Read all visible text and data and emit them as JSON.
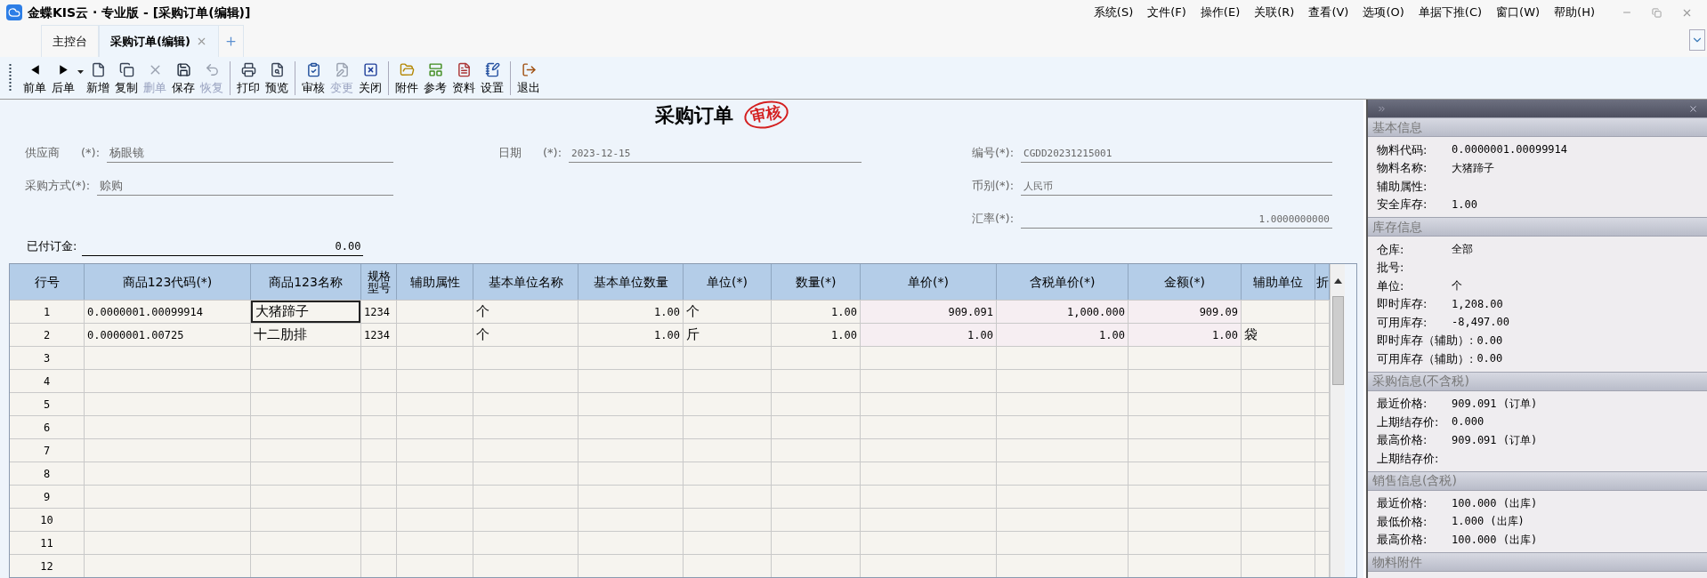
{
  "window": {
    "title": "金蝶KIS云 · 专业版 - [采购订单(编辑)]"
  },
  "menu": [
    "系统(S)",
    "文件(F)",
    "操作(E)",
    "关联(R)",
    "查看(V)",
    "选项(O)",
    "单据下推(C)",
    "窗口(W)",
    "帮助(H)"
  ],
  "tabs": [
    {
      "label": "主控台",
      "selected": false,
      "closable": false
    },
    {
      "label": "采购订单(编辑)",
      "selected": true,
      "closable": true
    }
  ],
  "toolbar": [
    [
      {
        "label": "前单",
        "disabled": false,
        "dropdown": false
      },
      {
        "label": "后单",
        "disabled": false,
        "dropdown": true
      },
      {
        "label": "新增",
        "disabled": false,
        "dropdown": false
      },
      {
        "label": "复制",
        "disabled": false,
        "dropdown": false
      },
      {
        "label": "删单",
        "disabled": true,
        "dropdown": false
      },
      {
        "label": "保存",
        "disabled": false,
        "dropdown": false
      },
      {
        "label": "恢复",
        "disabled": true,
        "dropdown": false
      }
    ],
    [
      {
        "label": "打印",
        "disabled": false,
        "dropdown": false
      },
      {
        "label": "预览",
        "disabled": false,
        "dropdown": false
      }
    ],
    [
      {
        "label": "审核",
        "disabled": false,
        "dropdown": false
      },
      {
        "label": "变更",
        "disabled": true,
        "dropdown": false
      },
      {
        "label": "关闭",
        "disabled": false,
        "dropdown": false
      }
    ],
    [
      {
        "label": "附件",
        "disabled": false,
        "dropdown": false
      },
      {
        "label": "参考",
        "disabled": false,
        "dropdown": false
      },
      {
        "label": "资料",
        "disabled": false,
        "dropdown": false
      },
      {
        "label": "设置",
        "disabled": false,
        "dropdown": false
      }
    ],
    [
      {
        "label": "退出",
        "disabled": false,
        "dropdown": false
      }
    ]
  ],
  "form": {
    "title": "采购订单",
    "stamp": "审核",
    "left": [
      {
        "label": "供应商",
        "marker": "(*):",
        "value": "杨眼镜"
      },
      {
        "label": "采购方式(*):",
        "value": "赊购"
      }
    ],
    "middle": [
      {
        "label": "日期",
        "marker": "(*):",
        "value": "2023-12-15"
      }
    ],
    "right": [
      {
        "label": "编号(*):",
        "value": "CGDD20231215001"
      },
      {
        "label": "币别(*):",
        "value": "人民币"
      },
      {
        "label": "汇率(*):",
        "value": "1.0000000000",
        "numeric": true
      }
    ],
    "deposit": {
      "label": "已付订金:",
      "value": "0.00"
    }
  },
  "table": {
    "columns": [
      "行号",
      "商品123代码(*)",
      "商品123名称",
      "规格型号",
      "辅助属性",
      "基本单位名称",
      "基本单位数量",
      "单位(*)",
      "数量(*)",
      "单价(*)",
      "含税单价(*)",
      "金额(*)",
      "辅助单位",
      "折"
    ],
    "rows": [
      {
        "name_focused": true,
        "cells": [
          "1",
          "0.0000001.00099914",
          "大猪蹄子",
          "1234",
          "",
          "个",
          "1.00",
          "个",
          "1.00",
          "909.091",
          "1,000.000",
          "909.09",
          "",
          ""
        ]
      },
      {
        "name_focused": false,
        "cells": [
          "2",
          "0.0000001.00725",
          "十二肋排",
          "1234",
          "",
          "个",
          "1.00",
          "斤",
          "1.00",
          "1.00",
          "1.00",
          "1.00",
          "袋",
          ""
        ]
      },
      {
        "name_focused": false,
        "cells": [
          "3"
        ]
      },
      {
        "name_focused": false,
        "cells": [
          "4"
        ]
      },
      {
        "name_focused": false,
        "cells": [
          "5"
        ]
      },
      {
        "name_focused": false,
        "cells": [
          "6"
        ]
      },
      {
        "name_focused": false,
        "cells": [
          "7"
        ]
      },
      {
        "name_focused": false,
        "cells": [
          "8"
        ]
      },
      {
        "name_focused": false,
        "cells": [
          "9"
        ]
      },
      {
        "name_focused": false,
        "cells": [
          "10"
        ]
      },
      {
        "name_focused": false,
        "cells": [
          "11"
        ]
      },
      {
        "name_focused": false,
        "cells": [
          "12"
        ]
      }
    ]
  },
  "side_panel": {
    "sections": [
      {
        "title": "基本信息",
        "rows": [
          {
            "label": "物料代码:",
            "value": "0.0000001.00099914"
          },
          {
            "label": "物料名称:",
            "value": "大猪蹄子"
          },
          {
            "label": "辅助属性:",
            "value": ""
          },
          {
            "label": "安全库存:",
            "value": "1.00"
          }
        ]
      },
      {
        "title": "库存信息",
        "rows": [
          {
            "label": "仓库:",
            "value": "全部"
          },
          {
            "label": "批号:",
            "value": ""
          },
          {
            "label": "单位:",
            "value": "个"
          },
          {
            "label": "即时库存:",
            "value": "1,208.00"
          },
          {
            "label": "可用库存:",
            "value": "-8,497.00"
          },
          {
            "label": "即时库存（辅助）:",
            "value": "0.00"
          },
          {
            "label": "可用库存（辅助）:",
            "value": "0.00"
          }
        ]
      },
      {
        "title": "采购信息(不含税)",
        "rows": [
          {
            "label": "最近价格:",
            "value": "909.091 (订单)"
          },
          {
            "label": "上期结存价:",
            "value": "0.000"
          },
          {
            "label": "最高价格:",
            "value": "909.091 (订单)"
          },
          {
            "label": "上期结存价:",
            "value": ""
          }
        ]
      },
      {
        "title": "销售信息(含税)",
        "rows": [
          {
            "label": "最近价格:",
            "value": "100.000 (出库)"
          },
          {
            "label": "最低价格:",
            "value": "1.000 (出库)"
          },
          {
            "label": "最高价格:",
            "value": "100.000 (出库)"
          }
        ]
      },
      {
        "title": "物料附件"
      }
    ]
  }
}
